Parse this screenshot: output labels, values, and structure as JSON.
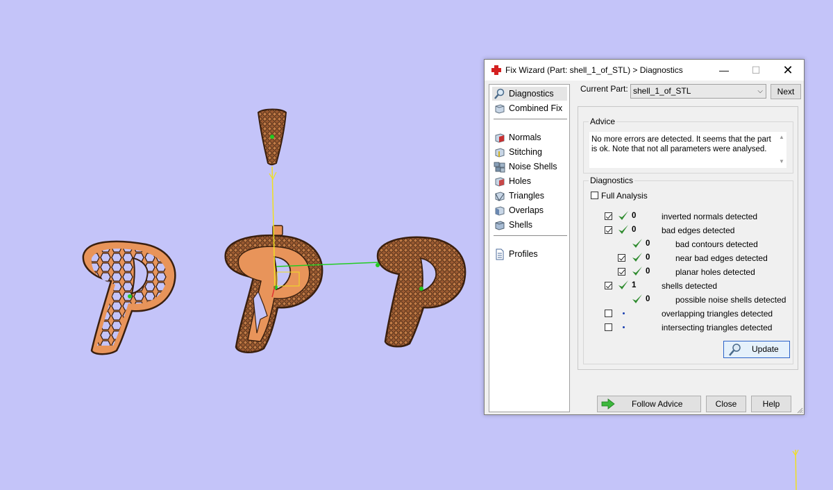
{
  "window": {
    "title": "Fix Wizard (Part: shell_1_of_STL) > Diagnostics",
    "minimize_glyph": "—",
    "maximize_glyph": "☐",
    "close_glyph": "✕"
  },
  "nav": {
    "items": [
      {
        "label": "Diagnostics",
        "icon": "magnifier-icon"
      },
      {
        "label": "Combined Fix",
        "icon": "cube-icon"
      },
      {
        "label": "Normals",
        "icon": "normals-cube-icon"
      },
      {
        "label": "Stitching",
        "icon": "stitching-cube-icon"
      },
      {
        "label": "Noise Shells",
        "icon": "noise-shells-icon"
      },
      {
        "label": "Holes",
        "icon": "holes-cube-icon"
      },
      {
        "label": "Triangles",
        "icon": "triangles-cube-icon"
      },
      {
        "label": "Overlaps",
        "icon": "overlaps-cube-icon"
      },
      {
        "label": "Shells",
        "icon": "shells-cube-icon"
      },
      {
        "label": "Profiles",
        "icon": "document-icon"
      }
    ]
  },
  "current_part": {
    "label": "Current Part:",
    "value": "shell_1_of_STL",
    "next_label": "Next"
  },
  "advice": {
    "title": "Advice",
    "text": "No more errors are detected. It seems that the part is ok. Note that not all parameters were analysed."
  },
  "diagnostics": {
    "title": "Diagnostics",
    "full_analysis_label": "Full Analysis",
    "full_analysis_checked": false,
    "rows": [
      {
        "count": "0",
        "label": "inverted normals detected",
        "checked": true,
        "status": "ok"
      },
      {
        "count": "0",
        "label": "bad edges detected",
        "checked": true,
        "status": "ok"
      },
      {
        "count": "0",
        "label": "bad contours detected",
        "checked": null,
        "status": "ok"
      },
      {
        "count": "0",
        "label": "near bad edges detected",
        "checked": true,
        "status": "ok"
      },
      {
        "count": "0",
        "label": "planar holes detected",
        "checked": true,
        "status": "ok"
      },
      {
        "count": "1",
        "label": "shells detected",
        "checked": true,
        "status": "ok"
      },
      {
        "count": "0",
        "label": "possible noise shells detected",
        "checked": null,
        "status": "ok"
      },
      {
        "count": "",
        "label": "overlapping triangles detected",
        "checked": false,
        "status": "not-run"
      },
      {
        "count": "",
        "label": "intersecting triangles detected",
        "checked": false,
        "status": "not-run"
      }
    ],
    "update_label": "Update"
  },
  "footer": {
    "follow_advice_label": "Follow Advice",
    "close_label": "Close",
    "help_label": "Help"
  },
  "colors": {
    "viewport_background": "#c4c4f9",
    "part_fill": "#e8945a",
    "part_outline": "#3a1f0e",
    "axis_yellow": "#f0e020",
    "axis_green": "#22cc22",
    "ok_tick_green": "#2e8b2e",
    "update_border": "#2a62c9"
  }
}
